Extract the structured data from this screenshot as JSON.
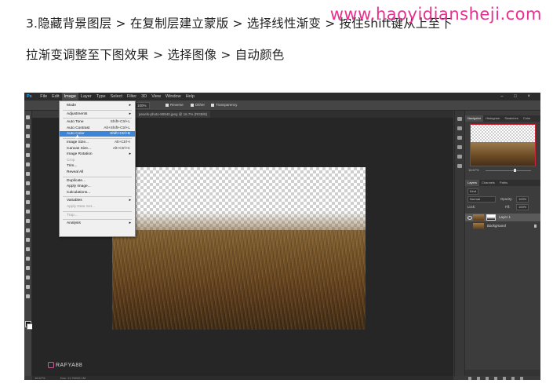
{
  "article": {
    "line1": "3.隐藏背景图层 > 在复制层建立蒙版 > 选择线性渐变 > 按住shift键从上至下",
    "line2": "拉渐变调整至下图效果 > 选择图像 > 自动颜色",
    "watermark": "www.haoyidiansheji.com"
  },
  "photoshop": {
    "logo": "Ps",
    "menubar": [
      "File",
      "Edit",
      "Image",
      "Layer",
      "Type",
      "Select",
      "Filter",
      "3D",
      "View",
      "Window",
      "Help"
    ],
    "active_menu": "Image",
    "window_controls": "– □ ×",
    "options": {
      "mode_label": "Mode:",
      "mode_value": "Normal",
      "opacity_label": "Opacity:",
      "opacity_value": "100%",
      "reverse": "Reverse",
      "dither": "Dither",
      "transparency": "Transparency"
    },
    "tabs": [
      "field_sto...",
      "pexels-photo-90840.jpeg @ 16.7% (RGB/8)"
    ],
    "image_menu": {
      "items": [
        {
          "label": "Mode",
          "shortcut": "",
          "submenu": true,
          "disabled": false
        },
        {
          "label": "Adjustments",
          "shortcut": "",
          "submenu": true,
          "disabled": false
        },
        {
          "label": "Auto Tone",
          "shortcut": "Shift+Ctrl+L",
          "submenu": false,
          "disabled": false
        },
        {
          "label": "Auto Contrast",
          "shortcut": "Alt+Shift+Ctrl+L",
          "submenu": false,
          "disabled": false
        },
        {
          "label": "Auto Color",
          "shortcut": "Shift+Ctrl+B",
          "submenu": false,
          "disabled": false,
          "highlighted": true
        },
        {
          "label": "Image Size...",
          "shortcut": "Alt+Ctrl+I",
          "submenu": false,
          "disabled": false
        },
        {
          "label": "Canvas Size...",
          "shortcut": "Alt+Ctrl+C",
          "submenu": false,
          "disabled": false
        },
        {
          "label": "Image Rotation",
          "shortcut": "",
          "submenu": true,
          "disabled": false
        },
        {
          "label": "Crop",
          "shortcut": "",
          "submenu": false,
          "disabled": true
        },
        {
          "label": "Trim...",
          "shortcut": "",
          "submenu": false,
          "disabled": false
        },
        {
          "label": "Reveal All",
          "shortcut": "",
          "submenu": false,
          "disabled": false
        },
        {
          "label": "Duplicate...",
          "shortcut": "",
          "submenu": false,
          "disabled": false
        },
        {
          "label": "Apply Image...",
          "shortcut": "",
          "submenu": false,
          "disabled": false
        },
        {
          "label": "Calculations...",
          "shortcut": "",
          "submenu": false,
          "disabled": false
        },
        {
          "label": "Variables",
          "shortcut": "",
          "submenu": true,
          "disabled": false
        },
        {
          "label": "Apply Data Set...",
          "shortcut": "",
          "submenu": false,
          "disabled": true
        },
        {
          "label": "Trap...",
          "shortcut": "",
          "submenu": false,
          "disabled": true
        },
        {
          "label": "Analysis",
          "shortcut": "",
          "submenu": true,
          "disabled": false
        }
      ]
    },
    "status": {
      "zoom": "16.67%",
      "doc": "Doc: 11.7M/32.1M"
    },
    "signature": "RAFYA88",
    "panels": {
      "navigator_tabs": [
        "Navigator",
        "Histogram",
        "Swatches",
        "Color"
      ],
      "navigator_zoom": "16.67%",
      "layers_tabs": [
        "Layers",
        "Channels",
        "Paths"
      ],
      "kind_label": "Kind",
      "blend_mode": "Normal",
      "opacity_label": "Opacity:",
      "opacity_value": "100%",
      "lock_label": "Lock:",
      "fill_label": "Fill:",
      "fill_value": "100%",
      "layers": [
        {
          "name": "Layer 1",
          "selected": true,
          "visible": true,
          "has_mask": true
        },
        {
          "name": "Background",
          "selected": false,
          "visible": false,
          "has_mask": false
        }
      ]
    }
  }
}
